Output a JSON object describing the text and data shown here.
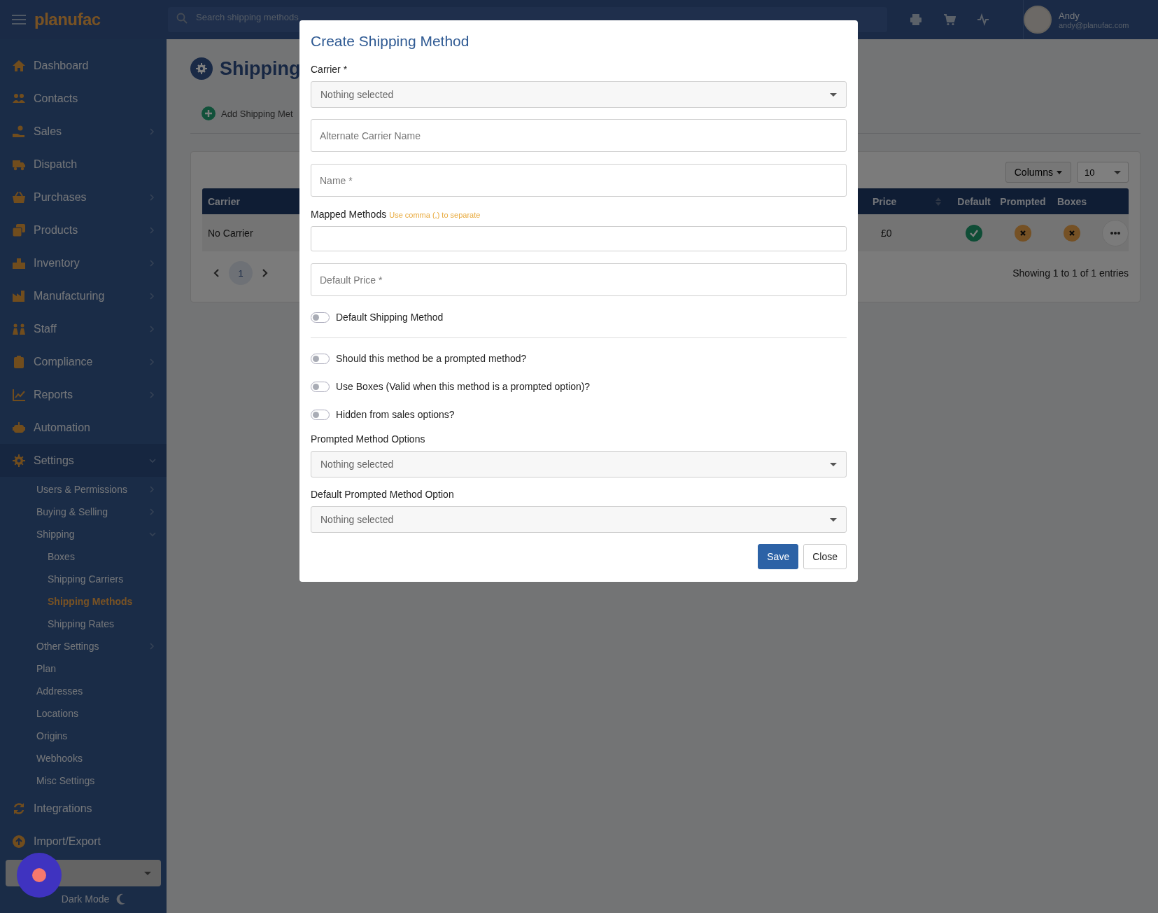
{
  "topbar": {
    "logo": "planufac",
    "search": {
      "placeholder": "Search shipping methods"
    },
    "user": {
      "name": "Andy",
      "email": "andy@planufac.com"
    }
  },
  "sidebar": {
    "items": [
      {
        "label": "Dashboard",
        "selected": false
      },
      {
        "label": "Contacts",
        "selected": false
      },
      {
        "label": "Sales",
        "expanded": false,
        "selected": false
      },
      {
        "label": "Dispatch",
        "selected": false
      },
      {
        "label": "Purchases",
        "expanded": false,
        "selected": false
      },
      {
        "label": "Products",
        "expanded": false,
        "selected": false
      },
      {
        "label": "Inventory",
        "expanded": false,
        "selected": false
      },
      {
        "label": "Manufacturing",
        "expanded": false,
        "selected": false
      },
      {
        "label": "Staff",
        "expanded": false,
        "selected": false
      },
      {
        "label": "Compliance",
        "expanded": false,
        "selected": false
      },
      {
        "label": "Reports",
        "expanded": false,
        "selected": false
      },
      {
        "label": "Automation",
        "selected": false
      },
      {
        "label": "Settings",
        "expanded": true,
        "selected": false,
        "children": [
          {
            "label": "Users & Permissions",
            "expanded": false,
            "selected": false
          },
          {
            "label": "Buying & Selling",
            "expanded": false,
            "selected": false
          },
          {
            "label": "Shipping",
            "expanded": true,
            "selected": false,
            "children": [
              {
                "label": "Boxes",
                "selected": false
              },
              {
                "label": "Shipping Carriers",
                "selected": false
              },
              {
                "label": "Shipping Methods",
                "selected": true
              },
              {
                "label": "Shipping Rates",
                "selected": false
              }
            ]
          },
          {
            "label": "Other Settings",
            "expanded": false,
            "selected": false
          },
          {
            "label": "Plan",
            "selected": false
          },
          {
            "label": "Addresses",
            "selected": false
          },
          {
            "label": "Locations",
            "selected": false
          },
          {
            "label": "Origins",
            "selected": false
          },
          {
            "label": "Webhooks",
            "selected": false
          },
          {
            "label": "Misc Settings",
            "selected": false
          }
        ]
      },
      {
        "label": "Integrations",
        "selected": false
      },
      {
        "label": "Import/Export",
        "selected": false
      }
    ],
    "dark_mode": "Dark Mode"
  },
  "page": {
    "title": "Shipping",
    "add_button": "Add Shipping Met",
    "table": {
      "columns_button": "Columns",
      "page_size": "10",
      "columns": [
        {
          "label": "Carrier"
        },
        {
          "label": "Price",
          "sortable": true
        },
        {
          "label": "Default"
        },
        {
          "label": "Prompted"
        },
        {
          "label": "Boxes"
        }
      ],
      "rows": [
        {
          "carrier": "No Carrier",
          "price": "£0",
          "default": true,
          "prompted": false,
          "boxes": false
        }
      ],
      "pages": [
        {
          "label": "1",
          "selected": true
        }
      ],
      "info": "Showing 1 to 1 of 1 entries"
    }
  },
  "modal": {
    "title": "Create Shipping Method",
    "carrier": {
      "label": "Carrier *",
      "placeholder": "Nothing selected"
    },
    "alternate_name": {
      "placeholder": "Alternate Carrier Name"
    },
    "name": {
      "placeholder": "Name *"
    },
    "mapped_methods": {
      "label": "Mapped Methods",
      "hint": "Use comma (,) to separate"
    },
    "default_price": {
      "placeholder": "Default Price *"
    },
    "default_toggle": {
      "label": "Default Shipping Method",
      "on": false
    },
    "toggles": [
      {
        "label": "Should this method be a prompted method?",
        "on": false
      },
      {
        "label": "Use Boxes (Valid when this method is a prompted option)?",
        "on": false
      },
      {
        "label": "Hidden from sales options?",
        "on": false
      }
    ],
    "prompted_options": {
      "label": "Prompted Method Options",
      "placeholder": "Nothing selected"
    },
    "default_prompted": {
      "label": "Default Prompted Method Option",
      "placeholder": "Nothing selected"
    },
    "buttons": [
      {
        "label": "Save",
        "kind": "primary"
      },
      {
        "label": "Close",
        "kind": "secondary"
      }
    ]
  }
}
